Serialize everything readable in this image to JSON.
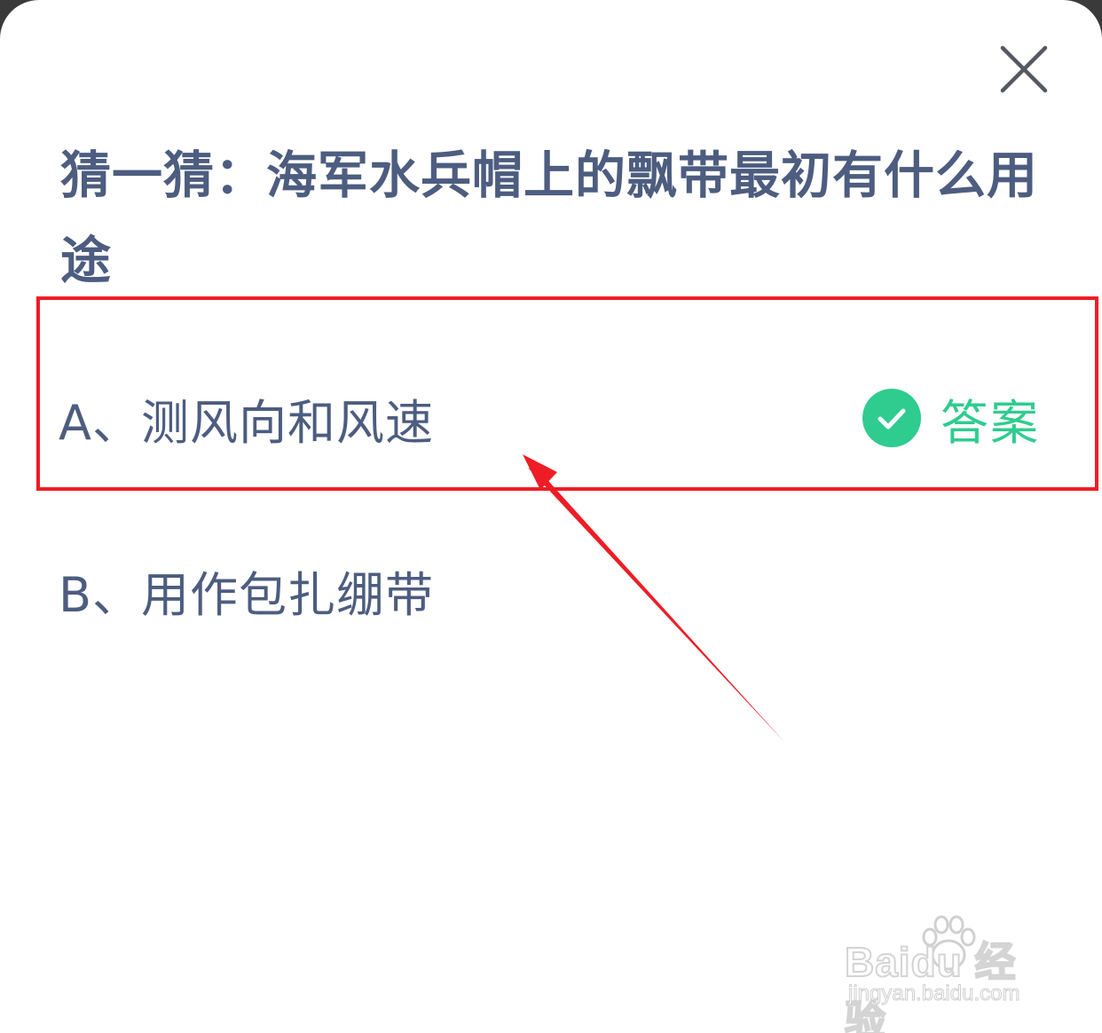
{
  "dialog": {
    "question": "猜一猜：海军水兵帽上的飘带最初有什么用途",
    "options": [
      {
        "label": "A、测风向和风速",
        "is_answer": true,
        "answer_label": "答案"
      },
      {
        "label": "B、用作包扎绷带",
        "is_answer": false
      }
    ],
    "close_icon": "close-icon",
    "check_icon": "check-circle-icon"
  },
  "annotation": {
    "highlight_color": "#ee1c25",
    "arrow_color": "#ee1c25"
  },
  "watermark": {
    "logo_text": "Baidu 经验",
    "url": "jingyan.baidu.com"
  },
  "colors": {
    "question_text": "#4d5d80",
    "answer_green": "#2fcc8f",
    "background": "#ffffff"
  }
}
